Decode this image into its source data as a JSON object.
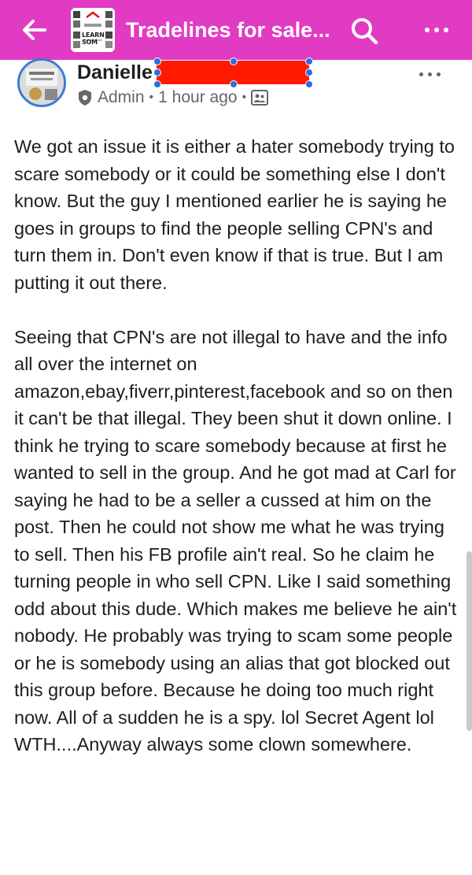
{
  "header": {
    "back_icon": "arrow-left-icon",
    "group_thumb_text": "LEARN SOM",
    "title": "Tradelines for sale...",
    "search_icon": "search-icon",
    "more_icon": "more-horizontal-icon",
    "color": "#e13bc3"
  },
  "post": {
    "author": "Danielle",
    "role": "Admin",
    "time": "1 hour ago",
    "separator": "•",
    "role_icon": "admin-badge-icon",
    "audience_icon": "group-audience-icon",
    "more_icon": "more-horizontal-icon",
    "paragraphs": [
      "We got an issue it is either a hater somebody trying to scare somebody or it could be something else I don't know. But the guy I mentioned earlier he is saying he goes in groups to find the people selling CPN's and turn them in. Don't even know if that is true. But I am putting it out there.",
      "Seeing that CPN's are not illegal to have and the info all over the internet on amazon,ebay,fiverr,pinterest,facebook and so on then it can't be that illegal. They been shut it down online. I think he trying to scare somebody because at first he wanted to sell in the group. And he got mad at Carl for saying he had to be a seller a cussed at him on the post. Then he could not show me what he was trying to sell. Then his FB profile ain't real. So he claim he turning people in who sell CPN. Like I said something odd about this dude. Which makes me believe he ain't nobody. He probably was trying to scam some people or he is somebody using an alias that got blocked out this group before. Because he doing too much right now. All of a sudden he is a spy. lol Secret Agent lol WTH....Anyway always some clown somewhere."
    ]
  }
}
